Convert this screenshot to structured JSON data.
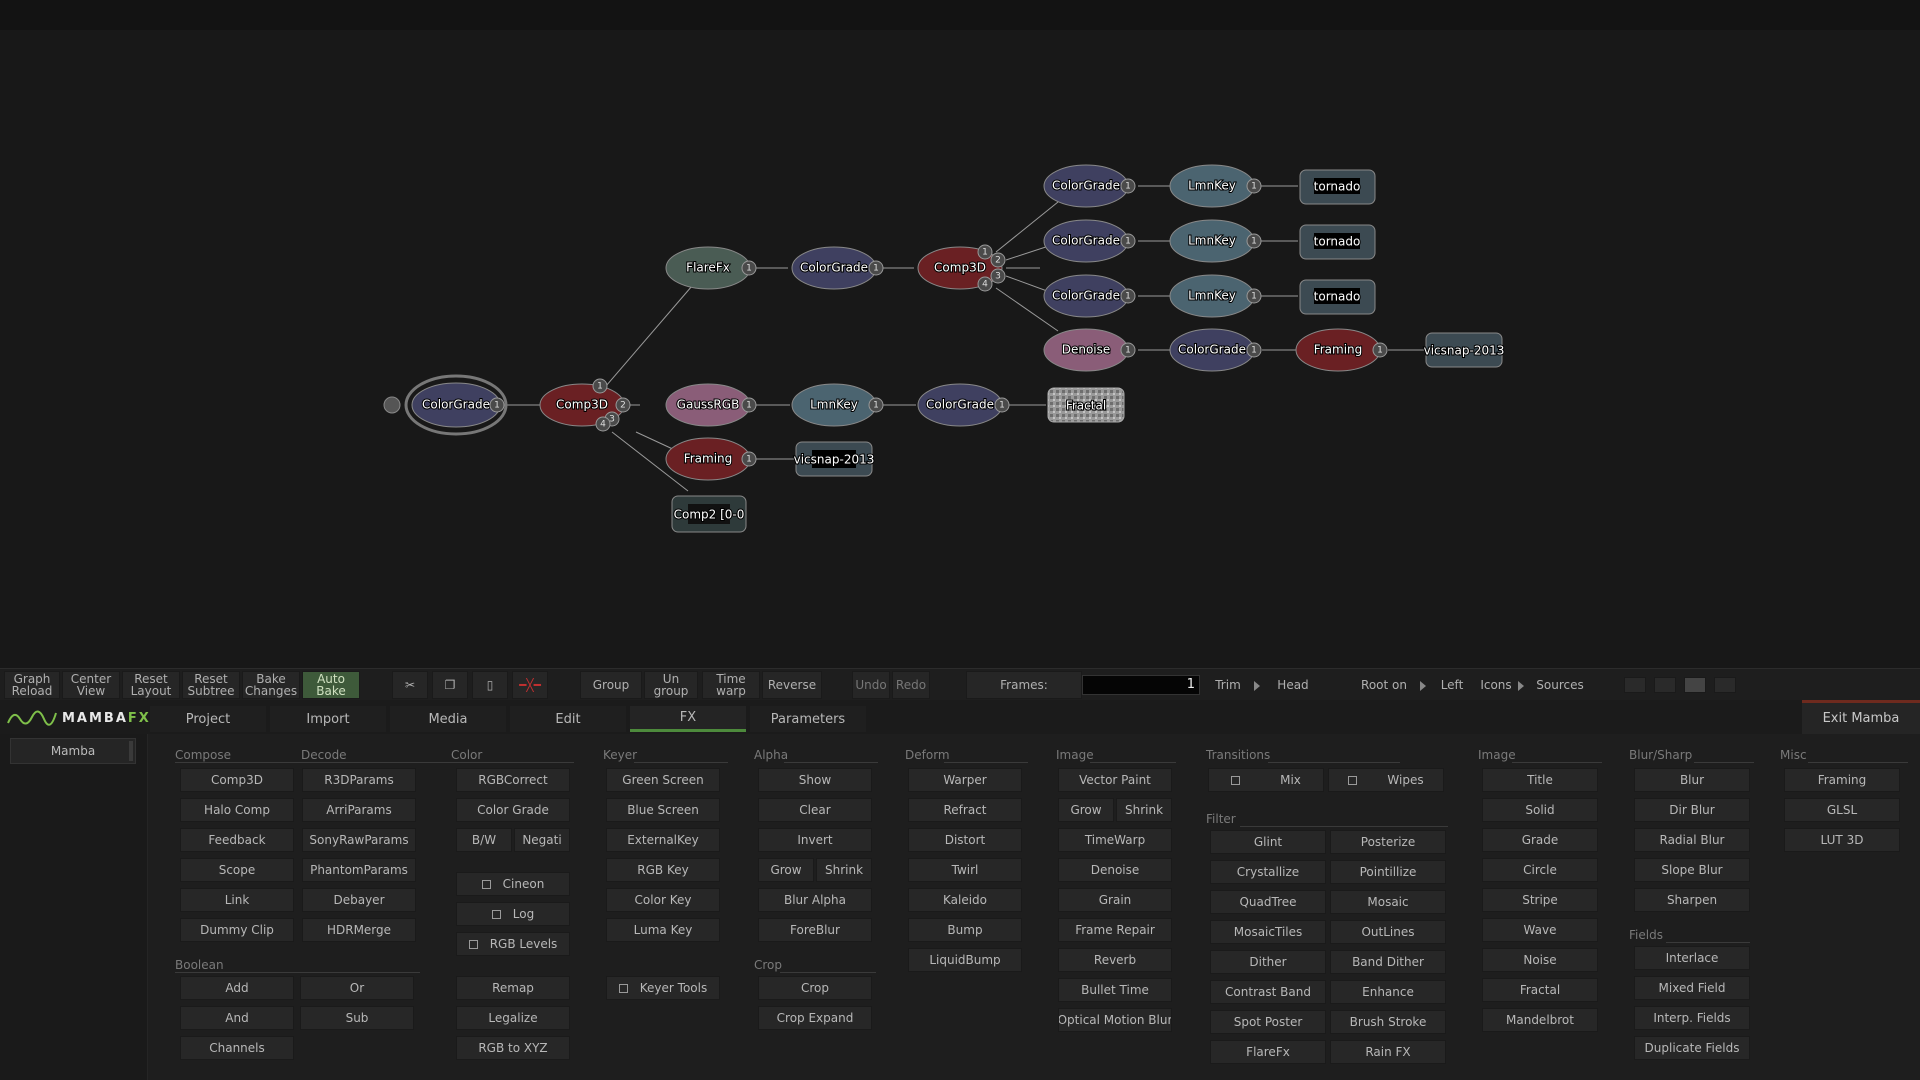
{
  "graph": {
    "nodes": [
      {
        "id": "n1",
        "label": "ColorGrade",
        "kind": "color",
        "selected": true
      },
      {
        "id": "n2",
        "label": "Comp3D",
        "kind": "comp"
      },
      {
        "id": "n3",
        "label": "FlareFx",
        "kind": "green"
      },
      {
        "id": "n4",
        "label": "ColorGrade",
        "kind": "color"
      },
      {
        "id": "n5",
        "label": "Comp3D",
        "kind": "comp"
      },
      {
        "id": "n6",
        "label": "ColorGrade",
        "kind": "color"
      },
      {
        "id": "n7",
        "label": "LmnKey",
        "kind": "key"
      },
      {
        "id": "n8",
        "label": "tornado",
        "kind": "source"
      },
      {
        "id": "n9",
        "label": "ColorGrade",
        "kind": "color"
      },
      {
        "id": "n10",
        "label": "LmnKey",
        "kind": "key"
      },
      {
        "id": "n11",
        "label": "tornado",
        "kind": "source"
      },
      {
        "id": "n12",
        "label": "ColorGrade",
        "kind": "color"
      },
      {
        "id": "n13",
        "label": "LmnKey",
        "kind": "key"
      },
      {
        "id": "n14",
        "label": "tornado",
        "kind": "source"
      },
      {
        "id": "n15",
        "label": "Denoise",
        "kind": "pink"
      },
      {
        "id": "n16",
        "label": "ColorGrade",
        "kind": "color"
      },
      {
        "id": "n17",
        "label": "Framing",
        "kind": "comp"
      },
      {
        "id": "n18",
        "label": "vicsnap-2013",
        "kind": "source"
      },
      {
        "id": "n19",
        "label": "GaussRGB",
        "kind": "pink"
      },
      {
        "id": "n20",
        "label": "LmnKey",
        "kind": "key"
      },
      {
        "id": "n21",
        "label": "ColorGrade",
        "kind": "color"
      },
      {
        "id": "n22",
        "label": "Fractal",
        "kind": "fractal"
      },
      {
        "id": "n23",
        "label": "Framing",
        "kind": "comp"
      },
      {
        "id": "n24",
        "label": "vicsnap-2013",
        "kind": "source"
      },
      {
        "id": "n25",
        "label": "Comp2 [0-0",
        "kind": "source"
      }
    ],
    "ports": [
      "1",
      "2",
      "3",
      "4"
    ],
    "colors": {
      "color": "#3f4060",
      "comp": "#6a2023",
      "green": "#4a5c54",
      "key": "#4b6470",
      "pink": "#8a5d78",
      "source": "#3c4a52",
      "fractal": "#8a8a8a",
      "wire": "#9a9a9a"
    }
  },
  "toolbar": {
    "graph_reload": "Graph Reload",
    "center_view": "Center View",
    "reset_layout": "Reset Layout",
    "reset_subtree": "Reset Subtree",
    "bake_changes": "Bake Changes",
    "auto_bake": "Auto Bake",
    "group": "Group",
    "ungroup": "Un group",
    "time_warp": "Time warp",
    "reverse": "Reverse",
    "undo": "Undo",
    "redo": "Redo",
    "frames_label": "Frames:",
    "frames_value": "1",
    "trim": "Trim",
    "head": "Head",
    "root_on": "Root on",
    "left": "Left",
    "icons": "Icons",
    "sources": "Sources"
  },
  "tabs": {
    "logo": "MAMBA",
    "logo_fx": "FX",
    "items": [
      "Project",
      "Import",
      "Media",
      "Edit",
      "FX",
      "Parameters"
    ],
    "active": "FX",
    "exit": "Exit Mamba"
  },
  "left": {
    "mamba": "Mamba"
  },
  "fx": {
    "compose": {
      "title": "Compose",
      "items": [
        "Comp3D",
        "Halo Comp",
        "Feedback",
        "Scope",
        "Link",
        "Dummy Clip"
      ]
    },
    "decode": {
      "title": "Decode",
      "items": [
        "R3DParams",
        "ArriParams",
        "SonyRawParams",
        "PhantomParams",
        "Debayer",
        "HDRMerge"
      ]
    },
    "boolean": {
      "title": "Boolean",
      "items": [
        "Add",
        "Or",
        "And",
        "Sub",
        "Channels"
      ]
    },
    "color": {
      "title": "Color",
      "items": [
        "RGBCorrect",
        "Color Grade",
        "B/W",
        "Negati",
        "Cineon",
        "Log",
        "RGB Levels",
        "Remap",
        "Legalize",
        "RGB to XYZ"
      ]
    },
    "keyer": {
      "title": "Keyer",
      "items": [
        "Green Screen",
        "Blue Screen",
        "ExternalKey",
        "RGB Key",
        "Color Key",
        "Luma Key",
        "Keyer Tools"
      ]
    },
    "alpha": {
      "title": "Alpha",
      "items": [
        "Show",
        "Clear",
        "Invert",
        "Grow",
        "Shrink",
        "Blur Alpha",
        "ForeBlur"
      ]
    },
    "crop": {
      "title": "Crop",
      "items": [
        "Crop",
        "Crop Expand"
      ]
    },
    "deform": {
      "title": "Deform",
      "items": [
        "Warper",
        "Refract",
        "Distort",
        "Twirl",
        "Kaleido",
        "Bump",
        "LiquidBump"
      ]
    },
    "image": {
      "title": "Image",
      "items": [
        "Vector Paint",
        "Grow",
        "Shrink",
        "TimeWarp",
        "Denoise",
        "Grain",
        "Frame Repair",
        "Reverb",
        "Bullet Time",
        "Optical Motion Blur"
      ]
    },
    "transitions": {
      "title": "Transitions",
      "items": [
        "Mix",
        "Wipes"
      ]
    },
    "filter": {
      "title": "Filter",
      "items": [
        "Glint",
        "Posterize",
        "Crystallize",
        "Pointillize",
        "QuadTree",
        "Mosaic",
        "MosaicTiles",
        "OutLines",
        "Dither",
        "Band Dither",
        "Contrast Band",
        "Enhance",
        "Spot Poster",
        "Brush Stroke",
        "FlareFx",
        "Rain FX"
      ]
    },
    "image2": {
      "title": "Image",
      "items": [
        "Title",
        "Solid",
        "Grade",
        "Circle",
        "Stripe",
        "Wave",
        "Noise",
        "Fractal",
        "Mandelbrot"
      ]
    },
    "blur": {
      "title": "Blur/Sharp",
      "items": [
        "Blur",
        "Dir Blur",
        "Radial Blur",
        "Slope Blur",
        "Sharpen"
      ]
    },
    "fields": {
      "title": "Fields",
      "items": [
        "Interlace",
        "Mixed Field",
        "Interp. Fields",
        "Duplicate Fields"
      ]
    },
    "misc": {
      "title": "Misc",
      "items": [
        "Framing",
        "GLSL",
        "LUT 3D"
      ]
    }
  }
}
